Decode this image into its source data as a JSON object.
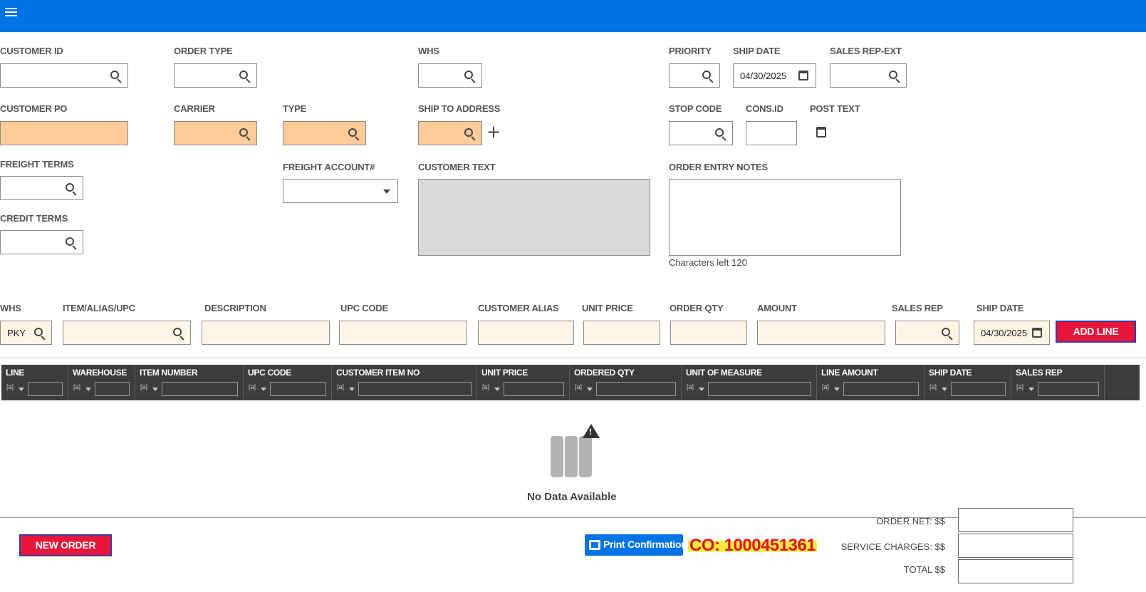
{
  "header": {
    "menu_icon": "hamburger-menu-icon",
    "color": "#0073e6"
  },
  "order_form": {
    "customer_id": {
      "label": "CUSTOMER ID",
      "value": ""
    },
    "order_type": {
      "label": "ORDER TYPE",
      "value": ""
    },
    "whs": {
      "label": "WHS",
      "value": ""
    },
    "priority": {
      "label": "PRIORITY",
      "value": ""
    },
    "ship_date": {
      "label": "SHIP DATE",
      "value": "04/30/2025"
    },
    "sales_rep_ext": {
      "label": "SALES REP-EXT",
      "value": ""
    },
    "customer_po": {
      "label": "CUSTOMER PO",
      "value": ""
    },
    "carrier": {
      "label": "CARRIER",
      "value": ""
    },
    "type": {
      "label": "TYPE",
      "value": ""
    },
    "ship_to_address": {
      "label": "SHIP TO ADDRESS",
      "value": ""
    },
    "stop_code": {
      "label": "STOP CODE",
      "value": ""
    },
    "cons_id": {
      "label": "CONS.ID",
      "value": ""
    },
    "post_text": {
      "label": "POST TEXT"
    },
    "freight_terms": {
      "label": "FREIGHT TERMS",
      "value": ""
    },
    "freight_account": {
      "label": "FREIGHT ACCOUNT#",
      "value": ""
    },
    "customer_text": {
      "label": "CUSTOMER TEXT",
      "value": ""
    },
    "order_entry_notes": {
      "label": "ORDER ENTRY NOTES",
      "value": "",
      "chars_left": "Characters left 120"
    },
    "credit_terms": {
      "label": "CREDIT TERMS",
      "value": ""
    }
  },
  "line_entry": {
    "whs": {
      "label": "WHS",
      "value": "PKY"
    },
    "item": {
      "label": "ITEM/ALIAS/UPC",
      "value": ""
    },
    "description": {
      "label": "DESCRIPTION",
      "value": ""
    },
    "upc_code": {
      "label": "UPC CODE",
      "value": ""
    },
    "customer_alias": {
      "label": "CUSTOMER ALIAS",
      "value": ""
    },
    "unit_price": {
      "label": "UNIT PRICE",
      "value": ""
    },
    "order_qty": {
      "label": "ORDER QTY",
      "value": ""
    },
    "amount": {
      "label": "AMOUNT",
      "value": ""
    },
    "sales_rep": {
      "label": "SALES REP",
      "value": ""
    },
    "ship_date": {
      "label": "SHIP DATE",
      "value": "04/30/2025"
    },
    "add_line": "ADD LINE"
  },
  "grid": {
    "columns": [
      "LINE",
      "WAREHOUSE",
      "ITEM NUMBER",
      "UPC CODE",
      "CUSTOMER ITEM NO",
      "UNIT PRICE",
      "ORDERED QTY",
      "UNIT OF MEASURE",
      "LINE AMOUNT",
      "SHIP DATE",
      "SALES REP"
    ],
    "filter_glyph": "[a]",
    "empty_text": "No Data Available"
  },
  "footer": {
    "new_order": "NEW ORDER",
    "print_confirmation": "Print Confirmation",
    "co_number": "CO: 1000451361",
    "order_net_label": "ORDER NET: $$",
    "service_charges_label": "SERVICE CHARGES: $$",
    "total_label": "TOTAL $$",
    "order_net": "",
    "service_charges": "",
    "total": ""
  },
  "colors": {
    "accent": "#0073e6",
    "required": "#ffcb99",
    "line_field": "#fff5e6",
    "danger": "#e8163b",
    "grid_header": "#3d3d3d"
  }
}
